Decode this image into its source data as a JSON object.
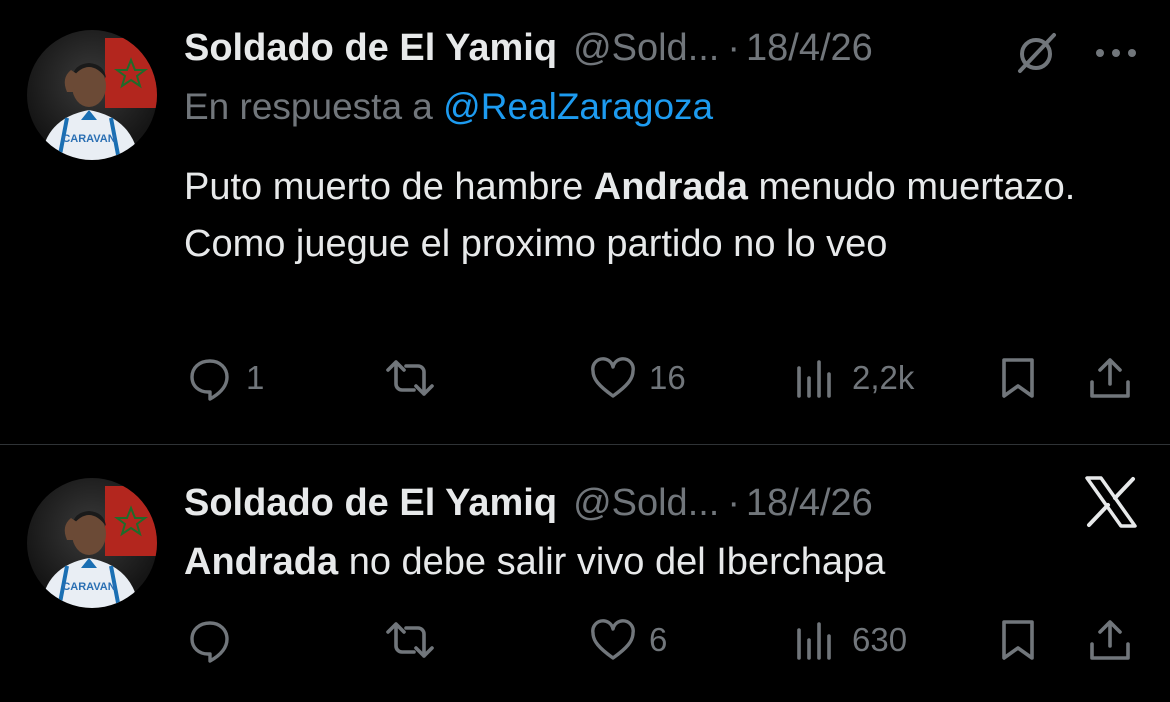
{
  "tweets": [
    {
      "author_name": "Soldado de El Yamiq",
      "author_handle": "@Sold...",
      "separator": "·",
      "date": "18/4/26",
      "reply_prefix": "En respuesta a",
      "reply_mention": "@RealZaragoza",
      "text_part1": "Puto muerto de hambre ",
      "text_bold": "Andrada",
      "text_part2": " menudo muertazo. Como juegue el proximo partido no lo veo",
      "avatar_shirt_text": "CARAVAN",
      "stats": {
        "replies": "1",
        "reposts": "",
        "likes": "16",
        "views": "2,2k"
      }
    },
    {
      "author_name": "Soldado de El Yamiq",
      "author_handle": "@Sold...",
      "separator": "·",
      "date": "18/4/26",
      "text_bold": "Andrada",
      "text_part2": " no debe salir vivo del Iberchapa",
      "avatar_shirt_text": "CARAVAN",
      "stats": {
        "replies": "",
        "reposts": "",
        "likes": "6",
        "views": "630"
      }
    }
  ],
  "colors": {
    "background": "#000000",
    "text": "#e7e9ea",
    "muted": "#71767b",
    "link": "#1d9bf0",
    "divider": "#2f3336"
  },
  "icons": [
    "grok-icon",
    "more-icon",
    "x-logo-icon",
    "reply-icon",
    "repost-icon",
    "like-icon",
    "views-icon",
    "bookmark-icon",
    "share-icon"
  ]
}
